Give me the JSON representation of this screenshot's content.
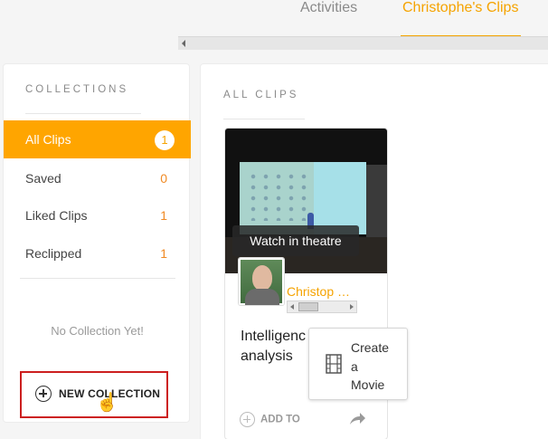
{
  "top_tabs": {
    "activities": "Activities",
    "clips": "Christophe's Clips"
  },
  "collections": {
    "title": "COLLECTIONS",
    "items": [
      {
        "label": "All Clips",
        "count": "1",
        "active": true
      },
      {
        "label": "Saved",
        "count": "0"
      },
      {
        "label": "Liked Clips",
        "count": "1"
      },
      {
        "label": "Reclipped",
        "count": "1"
      }
    ],
    "empty_note": "No Collection Yet!",
    "new_button": "NEW COLLECTION"
  },
  "clips": {
    "title": "ALL CLIPS",
    "card": {
      "overlay": "Watch in theatre",
      "author": "Christop …",
      "title_line1": "Intelligenc",
      "title_line2": "analysis",
      "add_to": "ADD TO"
    }
  },
  "popup": {
    "line1": "Create",
    "line2": "a",
    "line3": "Movie"
  },
  "colors": {
    "accent": "#ffa500",
    "count": "#f08a24",
    "highlight_border": "#cc1f1f"
  }
}
